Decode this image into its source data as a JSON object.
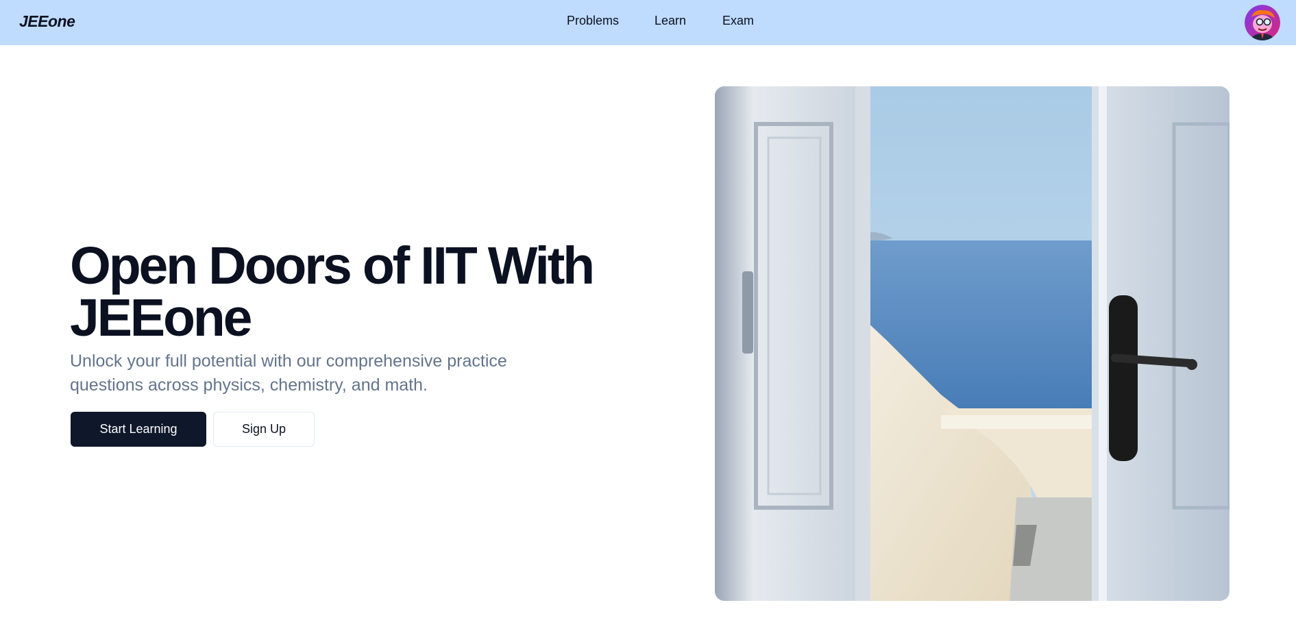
{
  "header": {
    "logo": "JEEone",
    "nav": [
      {
        "label": "Problems"
      },
      {
        "label": "Learn"
      },
      {
        "label": "Exam"
      }
    ]
  },
  "hero": {
    "title": "Open Doors of IIT With JEEone",
    "subtitle": "Unlock your full potential with our comprehensive practice questions across physics, chemistry, and math.",
    "primary_button": "Start Learning",
    "secondary_button": "Sign Up"
  },
  "colors": {
    "header_bg": "#bfdbfe",
    "primary_button_bg": "#0f172a",
    "subtitle_text": "#64748b"
  }
}
